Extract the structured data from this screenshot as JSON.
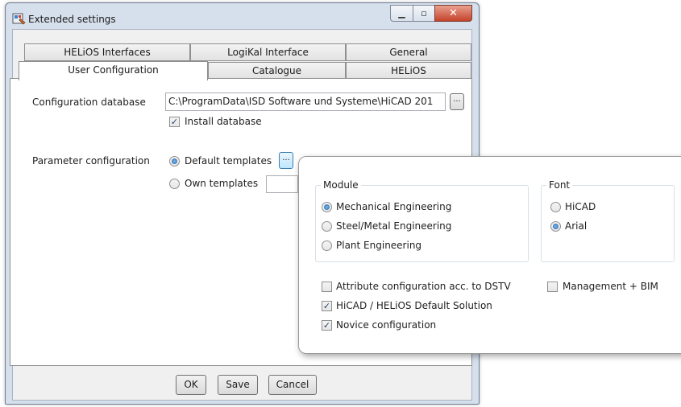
{
  "window": {
    "title": "Extended settings",
    "controls": {
      "minimize": "▁",
      "maximize": "▫",
      "close": "✕"
    }
  },
  "tabs": {
    "row1": [
      "HELiOS Interfaces",
      "LogiKal Interface",
      "General"
    ],
    "row2": [
      "User Configuration",
      "Catalogue",
      "HELiOS"
    ],
    "selected": "User Configuration"
  },
  "config": {
    "db_label": "Configuration database",
    "db_path": "C:\\ProgramData\\ISD Software und Systeme\\HiCAD 201",
    "browse": "...",
    "install_db": {
      "label": "Install database",
      "checked": true
    },
    "param_label": "Parameter configuration",
    "default_templates": {
      "label": "Default templates",
      "selected": true
    },
    "own_templates": {
      "label": "Own templates",
      "selected": false
    }
  },
  "buttons": {
    "ok": "OK",
    "save": "Save",
    "cancel": "Cancel"
  },
  "popup": {
    "module": {
      "title": "Module",
      "options": [
        {
          "label": "Mechanical Engineering",
          "selected": true
        },
        {
          "label": "Steel/Metal Engineering",
          "selected": false
        },
        {
          "label": "Plant Engineering",
          "selected": false
        }
      ]
    },
    "font": {
      "title": "Font",
      "options": [
        {
          "label": "HiCAD",
          "selected": false
        },
        {
          "label": "Arial",
          "selected": true
        }
      ]
    },
    "checks": [
      {
        "label": "Attribute configuration acc. to DSTV",
        "checked": false
      },
      {
        "label": "HiCAD / HELiOS Default Solution",
        "checked": true
      },
      {
        "label": "Novice configuration",
        "checked": false
      },
      {
        "label": "Management + BIM",
        "checked": false
      }
    ],
    "novice_checked": true
  },
  "colors": {
    "accent": "#1f5fa8",
    "window_frame": "#d6e0ec",
    "close": "#c5432b"
  }
}
